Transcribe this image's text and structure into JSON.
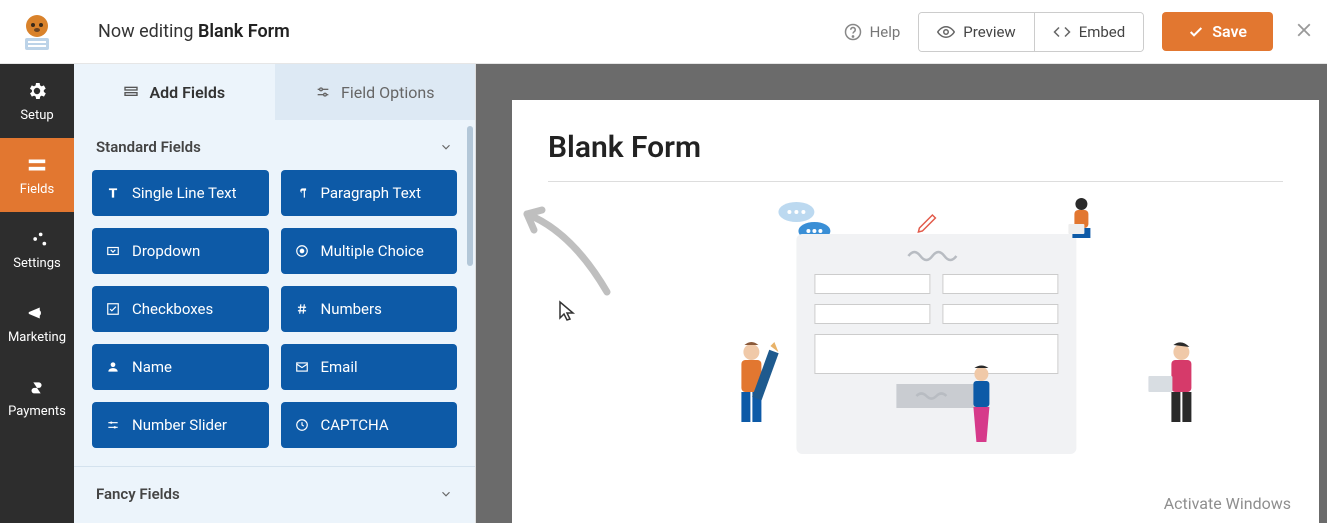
{
  "header": {
    "editing_prefix": "Now editing ",
    "editing_title": "Blank Form",
    "help": "Help",
    "preview": "Preview",
    "embed": "Embed",
    "save": "Save"
  },
  "leftnav": {
    "items": [
      {
        "label": "Setup"
      },
      {
        "label": "Fields"
      },
      {
        "label": "Settings"
      },
      {
        "label": "Marketing"
      },
      {
        "label": "Payments"
      }
    ]
  },
  "sidepanel": {
    "tabs": {
      "add_fields": "Add Fields",
      "field_options": "Field Options"
    },
    "groups": [
      {
        "title": "Standard Fields",
        "fields": [
          "Single Line Text",
          "Paragraph Text",
          "Dropdown",
          "Multiple Choice",
          "Checkboxes",
          "Numbers",
          "Name",
          "Email",
          "Number Slider",
          "CAPTCHA"
        ]
      },
      {
        "title": "Fancy Fields",
        "fields": []
      }
    ]
  },
  "canvas": {
    "form_title": "Blank Form"
  },
  "watermark": "Activate Windows"
}
